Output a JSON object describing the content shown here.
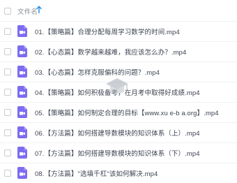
{
  "header": {
    "column_label": "文件名",
    "sort_icon": "arrow-up-icon"
  },
  "colors": {
    "accent": "#1e88e5",
    "video_icon": "#7c6cf0"
  },
  "files": [
    {
      "name": "01.【策略篇】合理分配每周学习数学的时间.mp4",
      "icon": "video-icon"
    },
    {
      "name": "02.【心态篇】数学越来越难，我应该怎么办？.mp4",
      "icon": "video-icon"
    },
    {
      "name": "03.【心态篇】怎样克服偏科的问题？.mp4",
      "icon": "video-icon"
    },
    {
      "name": "04.【策略篇】如何积极备考，在月考中取得好成绩.mp4",
      "icon": "video-icon"
    },
    {
      "name": "05.【策略篇】如何制定合理的目标【www.xu e-b a.org】.mp4",
      "icon": "video-icon"
    },
    {
      "name": "06.【方法篇】如何搭建导数模块的知识体系（上）.mp4",
      "icon": "video-icon"
    },
    {
      "name": "07.【方法篇】如何搭建导数模块的知识体系（下）.mp4",
      "icon": "video-icon"
    },
    {
      "name": "08.【方法篇】\"选填千杠\"该如何解决.mp4",
      "icon": "video-icon"
    }
  ]
}
